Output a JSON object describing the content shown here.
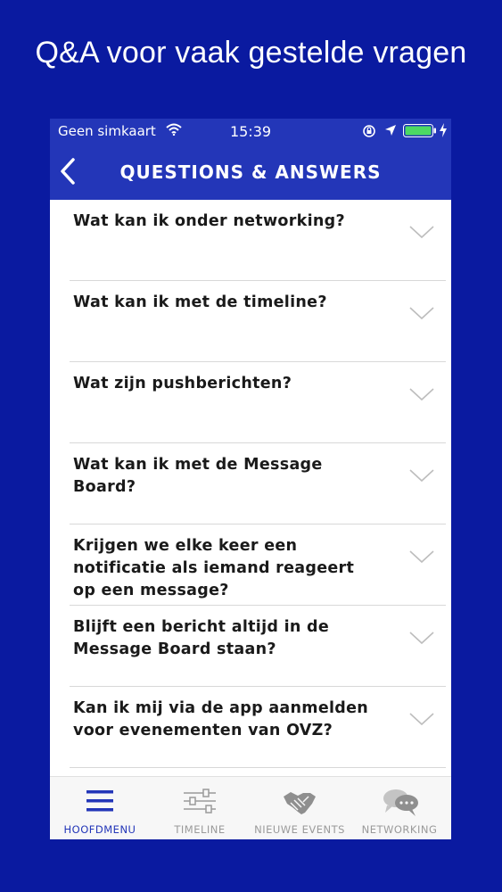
{
  "promo": {
    "title": "Q&A voor vaak gestelde vragen"
  },
  "status_bar": {
    "carrier": "Geen simkaart",
    "time": "15:39"
  },
  "nav": {
    "title": "QUESTIONS & ANSWERS"
  },
  "faq": [
    {
      "question": "Wat kan ik onder networking?"
    },
    {
      "question": "Wat kan ik met de timeline?"
    },
    {
      "question": "Wat zijn pushberichten?"
    },
    {
      "question": "Wat kan ik met de Message Board?"
    },
    {
      "question": "Krijgen we elke keer een notificatie als iemand reageert op een message?"
    },
    {
      "question": "Blijft een bericht altijd in de Message Board staan?"
    },
    {
      "question": "Kan ik mij via de app aanmelden voor evenementen van OVZ?"
    }
  ],
  "tabs": [
    {
      "label": "HOOFDMENU",
      "icon": "menu-icon",
      "active": true
    },
    {
      "label": "TIMELINE",
      "icon": "sliders-icon",
      "active": false
    },
    {
      "label": "NIEUWE EVENTS",
      "icon": "handshake-icon",
      "active": false
    },
    {
      "label": "NETWORKING",
      "icon": "chat-bubbles-icon",
      "active": false
    }
  ],
  "colors": {
    "background": "#0a1aa0",
    "header": "#2336b8",
    "active_tab": "#2336b8",
    "inactive_tab": "#9a9a9a"
  }
}
